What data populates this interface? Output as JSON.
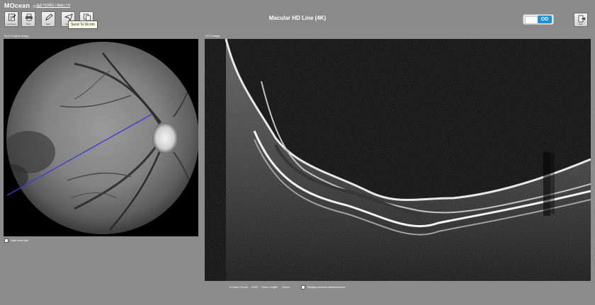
{
  "app": {
    "brand": "MOcean",
    "brand_version": "3000",
    "breadcrumb": "S F HONG / Main / N",
    "title": "Macular HD Line (4K)"
  },
  "toolbar": {
    "buttons": [
      {
        "label": "Comment",
        "icon": "edit-document-icon"
      },
      {
        "label": "Print",
        "icon": "printer-icon"
      },
      {
        "label": "Edit",
        "icon": "pen-icon"
      },
      {
        "label": "Send",
        "icon": "send-icon"
      },
      {
        "label": "Copy",
        "icon": "copy-icon"
      }
    ],
    "tooltip": "Send To Dicom"
  },
  "eye_toggle": {
    "value": "OD"
  },
  "exit_button": {
    "label": "Exit",
    "icon": "exit-door-icon"
  },
  "fundus_panel": {
    "label": "SLO Fundus Image",
    "hide_scan_line_label": "Hide scan line",
    "scan_line_color": "#3a3ad6"
  },
  "oct_panel": {
    "label": "OCT Image"
  },
  "footer": {
    "a_scan_count_label": "A-Scan Count:",
    "a_scan_count_value": "4000",
    "scan_length_label": "Scan Length:",
    "scan_length_value": "12mm",
    "display_measurement_label": "Display manual measurement"
  },
  "colors": {
    "background": "#8c8c8c",
    "toggle_accent": "#1e8fd8"
  }
}
